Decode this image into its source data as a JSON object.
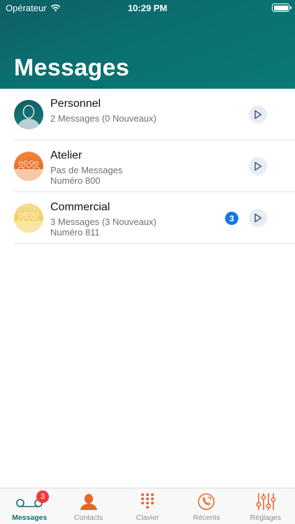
{
  "status_bar": {
    "carrier": "Opérateur",
    "time": "10:29 PM"
  },
  "header": {
    "title": "Messages"
  },
  "colors": {
    "header": "#0b6e70",
    "accent": "#e8672a",
    "badge_blue": "#1676e0",
    "badge_red": "#ef3b3b"
  },
  "mailboxes": [
    {
      "name": "Personnel",
      "line1": "2 Messages (0 Nouveaux)",
      "line2": "",
      "badge": "",
      "avatar": "person-avatar-icon"
    },
    {
      "name": "Atelier",
      "line1": "Pas de Messages",
      "line2": "Numéro 800",
      "badge": "",
      "avatar": "group-avatar-icon"
    },
    {
      "name": "Commercial",
      "line1": "3 Messages (3 Nouveaux)",
      "line2": "Numéro 811",
      "badge": "3",
      "avatar": "group-avatar-icon"
    }
  ],
  "tabbar": {
    "messages": {
      "label": "Messages",
      "badge": "3"
    },
    "contacts": {
      "label": "Contacts"
    },
    "keypad": {
      "label": "Clavier"
    },
    "recents": {
      "label": "Récents"
    },
    "settings": {
      "label": "Réglages"
    }
  }
}
